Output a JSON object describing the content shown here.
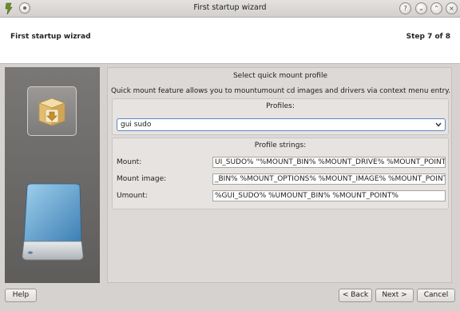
{
  "window": {
    "title": "First startup wizard"
  },
  "header": {
    "title": "First startup wizrad",
    "step": "Step 7 of 8"
  },
  "page": {
    "heading": "Select quick mount profile",
    "description": "Quick mount feature allows you to mountumount cd images and drivers via context menu entry."
  },
  "profiles": {
    "label": "Profiles:",
    "selected": "gui sudo"
  },
  "profile_strings": {
    "label": "Profile strings:",
    "mount_label": "Mount:",
    "mount_value": "UI_SUDO% \"%MOUNT_BIN% %MOUNT_DRIVE% %MOUNT_POINT%\"",
    "mount_image_label": "Mount image:",
    "mount_image_value": "_BIN% %MOUNT_OPTIONS% %MOUNT_IMAGE% %MOUNT_POINT%\"",
    "umount_label": "Umount:",
    "umount_value": "%GUI_SUDO% %UMOUNT_BIN% %MOUNT_POINT%"
  },
  "buttons": {
    "help": "Help",
    "back": "< Back",
    "next": "Next >",
    "cancel": "Cancel"
  },
  "icons": {
    "app": "app-icon",
    "package": "package-install-icon",
    "drive": "drive-icon"
  },
  "colors": {
    "focus_border": "#5b86c3",
    "side_panel": "#6b6a68"
  }
}
